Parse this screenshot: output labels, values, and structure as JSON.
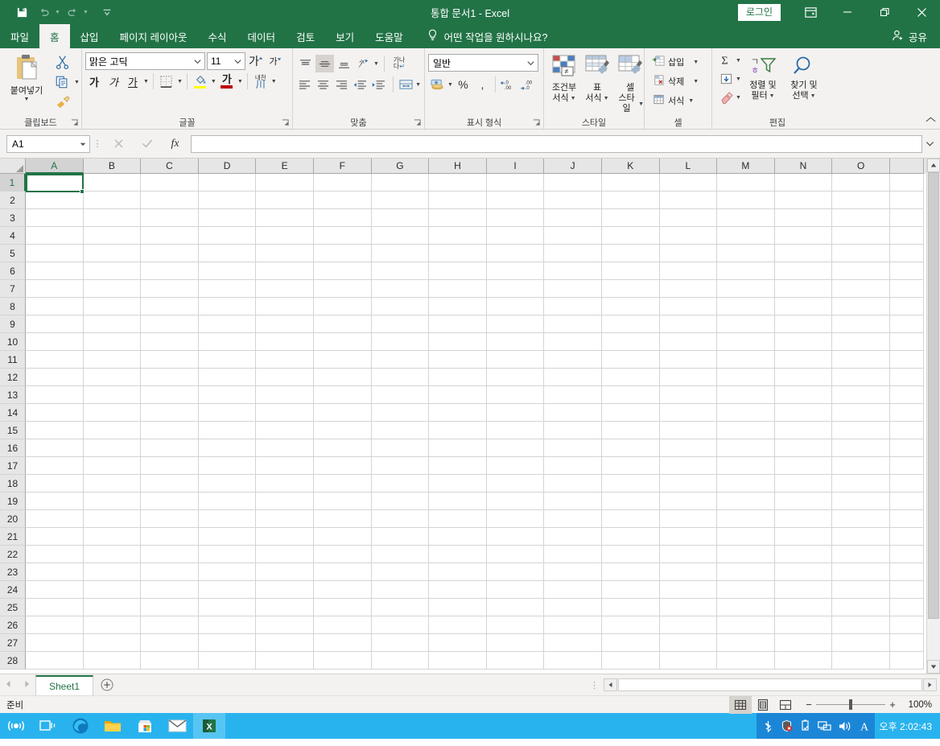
{
  "titlebar": {
    "document_title": "통합 문서1  -  Excel",
    "save_icon": "save-icon",
    "undo_icon": "undo-icon",
    "redo_icon": "redo-icon",
    "customize_qat_icon": "chevron-down-icon",
    "signin_label": "로그인",
    "ribbon_display_icon": "ribbon-display-options-icon",
    "minimize_icon": "minimize-icon",
    "restore_icon": "restore-icon",
    "close_icon": "close-icon"
  },
  "tabs": [
    {
      "label": "파일",
      "active": false
    },
    {
      "label": "홈",
      "active": true
    },
    {
      "label": "삽입",
      "active": false
    },
    {
      "label": "페이지 레이아웃",
      "active": false
    },
    {
      "label": "수식",
      "active": false
    },
    {
      "label": "데이터",
      "active": false
    },
    {
      "label": "검토",
      "active": false
    },
    {
      "label": "보기",
      "active": false
    },
    {
      "label": "도움말",
      "active": false
    }
  ],
  "tellme": {
    "icon": "lightbulb-icon",
    "placeholder": "어떤 작업을 원하시나요?"
  },
  "share": {
    "icon": "share-person-icon",
    "label": "공유"
  },
  "ribbon": {
    "clipboard": {
      "group_label": "클립보드",
      "paste_label": "붙여넣기",
      "cut_label": "잘라내기",
      "copy_label": "복사",
      "format_painter_label": "서식 복사"
    },
    "font": {
      "group_label": "글꼴",
      "font_name": "맑은 고딕",
      "font_size": "11",
      "grow_font": "가",
      "shrink_font": "가",
      "bold": "가",
      "italic": "가",
      "underline": "가",
      "borders_label": "테두리",
      "fill_color_label": "채우기 색",
      "font_color_label": "글꼴 색",
      "phonetic_label": "내천"
    },
    "alignment": {
      "group_label": "맞춤",
      "align_top": "위쪽 맞춤",
      "align_middle": "가운데 맞춤",
      "align_bottom": "아래쪽 맞춤",
      "orientation": "방향",
      "wrap_text": "텍스트 줄 바꿈",
      "wrap_text_glyph": "가나\n다",
      "align_left": "왼쪽 맞춤",
      "align_center": "가운데 맞춤",
      "align_right": "오른쪽 맞춤",
      "decrease_indent": "내어쓰기",
      "increase_indent": "들여쓰기",
      "merge_center": "병합하고 가운데 맞춤"
    },
    "number": {
      "group_label": "표시 형식",
      "format": "일반",
      "accounting": "회계 표시 형식",
      "percent": "%",
      "comma": ",",
      "increase_decimal": "자릿수 늘림",
      "decrease_decimal": "자릿수 줄임"
    },
    "styles": {
      "group_label": "스타일",
      "conditional_formatting": "조건부\n서식",
      "conditional_formatting_l1": "조건부",
      "conditional_formatting_l2": "서식",
      "format_as_table_l1": "표",
      "format_as_table_l2": "서식",
      "cell_styles_l1": "셀",
      "cell_styles_l2": "스타일"
    },
    "cells": {
      "group_label": "셀",
      "insert": "삽입",
      "delete": "삭제",
      "format": "서식"
    },
    "editing": {
      "group_label": "편집",
      "autosum": "자동 합계",
      "fill": "채우기",
      "clear": "지우기",
      "sort_filter_l1": "정렬 및",
      "sort_filter_l2": "필터",
      "find_select_l1": "찾기 및",
      "find_select_l2": "선택"
    },
    "collapse_icon": "chevron-up-icon"
  },
  "formulabar": {
    "name_box_value": "A1",
    "cancel_icon": "cancel-x-icon",
    "enter_icon": "confirm-check-icon",
    "function_icon": "fx-icon",
    "formula_value": "",
    "expand_icon": "chevron-down-icon"
  },
  "grid": {
    "columns": [
      "A",
      "B",
      "C",
      "D",
      "E",
      "F",
      "G",
      "H",
      "I",
      "J",
      "K",
      "L",
      "M",
      "N",
      "O"
    ],
    "rows": [
      1,
      2,
      3,
      4,
      5,
      6,
      7,
      8,
      9,
      10,
      11,
      12,
      13,
      14,
      15,
      16,
      17,
      18,
      19,
      20,
      21,
      22,
      23,
      24,
      25,
      26,
      27,
      28
    ],
    "selected_cell": "A1",
    "selected_column": "A",
    "selected_row": 1,
    "cells": {}
  },
  "sheetbar": {
    "prev_icon": "triangle-left-icon",
    "next_icon": "triangle-right-icon",
    "sheets": [
      {
        "name": "Sheet1",
        "active": true
      }
    ],
    "add_sheet_icon": "plus-circle-icon"
  },
  "statusbar": {
    "status_text": "준비",
    "view_normal_icon": "normal-view-icon",
    "view_pagelayout_icon": "page-layout-view-icon",
    "view_pagebreak_icon": "page-break-view-icon",
    "zoom_out": "−",
    "zoom_in": "+",
    "zoom_level": "100%"
  },
  "taskbar": {
    "items": [
      {
        "icon": "cortana-icon",
        "name": "cortana",
        "active": false
      },
      {
        "icon": "task-view-icon",
        "name": "task-view",
        "active": false
      },
      {
        "icon": "edge-icon",
        "name": "microsoft-edge",
        "active": false
      },
      {
        "icon": "file-explorer-icon",
        "name": "file-explorer",
        "active": false
      },
      {
        "icon": "microsoft-store-icon",
        "name": "microsoft-store",
        "active": false
      },
      {
        "icon": "mail-icon",
        "name": "mail",
        "active": false
      },
      {
        "icon": "excel-icon",
        "name": "excel",
        "active": true
      }
    ],
    "tray": [
      {
        "icon": "bluetooth-icon",
        "name": "bluetooth"
      },
      {
        "icon": "shield-icon",
        "name": "windows-security"
      },
      {
        "icon": "usb-icon",
        "name": "safely-remove-hardware"
      },
      {
        "icon": "network-icon",
        "name": "network"
      },
      {
        "icon": "volume-icon",
        "name": "volume"
      },
      {
        "icon": "ime-icon",
        "name": "input-method"
      }
    ],
    "clock": "오후 2:02:43"
  },
  "colors": {
    "excel_green": "#217346",
    "ribbon_bg": "#f3f2f1",
    "taskbar_blue": "#29b3ee",
    "tray_blue": "#1c86d6"
  }
}
